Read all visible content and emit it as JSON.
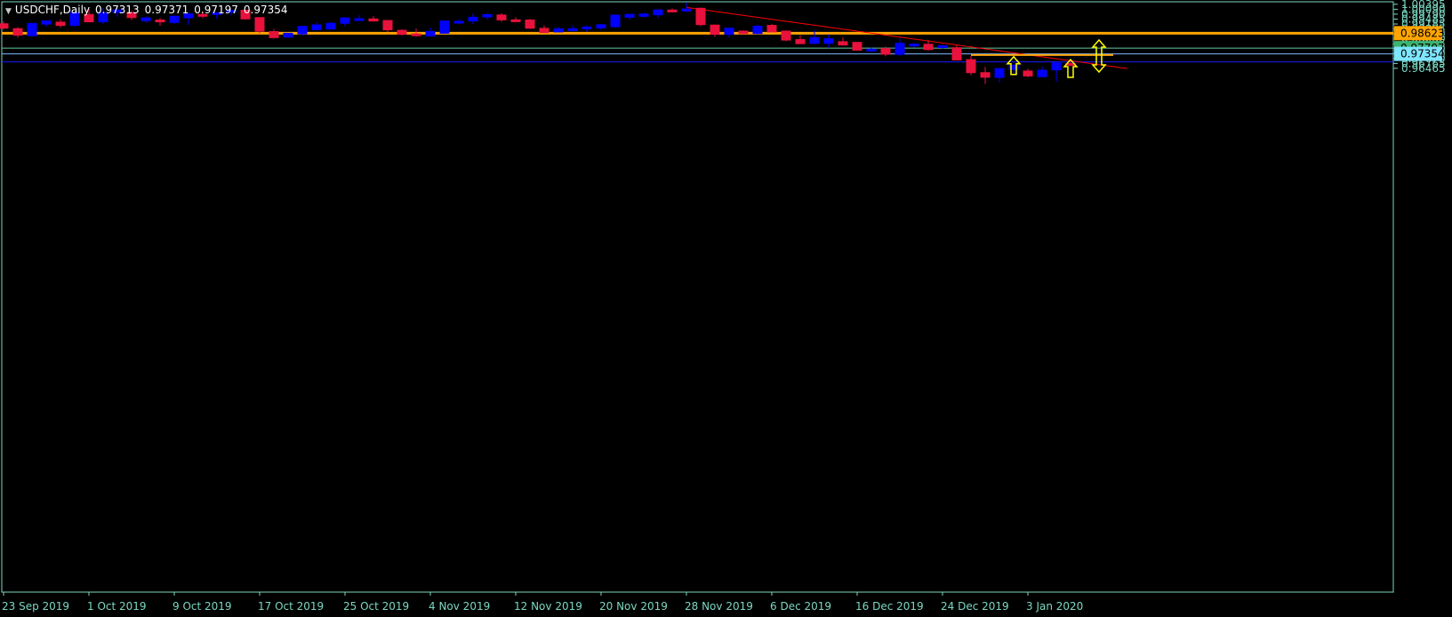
{
  "header": {
    "symbol": "USDCHF,Daily",
    "open": "0.97313",
    "high": "0.97371",
    "low": "0.97197",
    "close": "0.97354"
  },
  "colors": {
    "background": "#000000",
    "bull": "#0000ff",
    "bear": "#e8123c",
    "axis": "#7ad7c2",
    "trendline": "#ff0000",
    "support_line": "#ffa500",
    "resistance_line": "#66c9a0",
    "price_line": "#7ab8ff",
    "low_line": "#1a1aff",
    "arrows": "#ffff00"
  },
  "chart_data": {
    "type": "candlestick",
    "y_range": [
      0.6432,
      1.0055
    ],
    "y_ticks": [
      "1.00395",
      "1.00090",
      "0.99790",
      "0.99485",
      "0.99185",
      "0.98885",
      "0.98580",
      "0.98280",
      "0.97975",
      "0.97670",
      "0.97370",
      "0.97070",
      "0.96765",
      "0.96465"
    ],
    "x_labels": [
      "23 Sep 2019",
      "1 Oct 2019",
      "9 Oct 2019",
      "17 Oct 2019",
      "25 Oct 2019",
      "4 Nov 2019",
      "12 Nov 2019",
      "20 Nov 2019",
      "28 Nov 2019",
      "6 Dec 2019",
      "16 Dec 2019",
      "24 Dec 2019",
      "3 Jan 2020"
    ],
    "candles": [
      {
        "o": 0.992,
        "h": 0.9935,
        "l": 0.9885,
        "c": 0.9893
      },
      {
        "o": 0.989,
        "h": 0.99,
        "l": 0.9833,
        "c": 0.985
      },
      {
        "o": 0.9847,
        "h": 0.9925,
        "l": 0.984,
        "c": 0.9922
      },
      {
        "o": 0.9918,
        "h": 0.993,
        "l": 0.99,
        "c": 0.9938
      },
      {
        "o": 0.993,
        "h": 0.9947,
        "l": 0.9897,
        "c": 0.991
      },
      {
        "o": 0.991,
        "h": 0.9992,
        "l": 0.9903,
        "c": 0.999
      },
      {
        "o": 0.9977,
        "h": 1.0012,
        "l": 0.993,
        "c": 0.9932
      },
      {
        "o": 0.9932,
        "h": 1.0018,
        "l": 0.992,
        "c": 0.9988
      },
      {
        "o": 0.999,
        "h": 1.0024,
        "l": 0.9962,
        "c": 1.0005
      },
      {
        "o": 0.9988,
        "h": 1.0001,
        "l": 0.9943,
        "c": 0.9958
      },
      {
        "o": 0.9939,
        "h": 0.9964,
        "l": 0.9926,
        "c": 0.9956
      },
      {
        "o": 0.9943,
        "h": 0.9955,
        "l": 0.9908,
        "c": 0.9932
      },
      {
        "o": 0.9928,
        "h": 0.9972,
        "l": 0.992,
        "c": 0.9966
      },
      {
        "o": 0.9957,
        "h": 0.9992,
        "l": 0.9912,
        "c": 0.998
      },
      {
        "o": 0.9977,
        "h": 0.9995,
        "l": 0.9955,
        "c": 0.9975
      },
      {
        "o": 0.998,
        "h": 0.999,
        "l": 0.995,
        "c": 0.9988
      },
      {
        "o": 0.9994,
        "h": 1.0007,
        "l": 0.9972,
        "c": 1.0002
      },
      {
        "o": 1.0003,
        "h": 1.0005,
        "l": 0.9945,
        "c": 0.995
      },
      {
        "o": 0.9958,
        "h": 0.9958,
        "l": 0.9862,
        "c": 0.9875
      },
      {
        "o": 0.9872,
        "h": 0.9888,
        "l": 0.983,
        "c": 0.9835
      },
      {
        "o": 0.9838,
        "h": 0.9862,
        "l": 0.9835,
        "c": 0.9862
      },
      {
        "o": 0.9858,
        "h": 0.989,
        "l": 0.985,
        "c": 0.9904
      },
      {
        "o": 0.9884,
        "h": 0.9928,
        "l": 0.988,
        "c": 0.9913
      },
      {
        "o": 0.9888,
        "h": 0.993,
        "l": 0.9887,
        "c": 0.9923
      },
      {
        "o": 0.9923,
        "h": 0.994,
        "l": 0.9905,
        "c": 0.9956
      },
      {
        "o": 0.9945,
        "h": 0.9972,
        "l": 0.9945,
        "c": 0.9951
      },
      {
        "o": 0.995,
        "h": 0.9966,
        "l": 0.9935,
        "c": 0.9937
      },
      {
        "o": 0.994,
        "h": 0.9943,
        "l": 0.9868,
        "c": 0.9883
      },
      {
        "o": 0.988,
        "h": 0.9885,
        "l": 0.9848,
        "c": 0.9855
      },
      {
        "o": 0.9858,
        "h": 0.989,
        "l": 0.984,
        "c": 0.9847
      },
      {
        "o": 0.9845,
        "h": 0.9895,
        "l": 0.9842,
        "c": 0.9873
      },
      {
        "o": 0.9862,
        "h": 0.9935,
        "l": 0.986,
        "c": 0.9937
      },
      {
        "o": 0.9928,
        "h": 0.9945,
        "l": 0.992,
        "c": 0.9935
      },
      {
        "o": 0.9937,
        "h": 0.9983,
        "l": 0.992,
        "c": 0.996
      },
      {
        "o": 0.9962,
        "h": 0.9985,
        "l": 0.9945,
        "c": 0.9976
      },
      {
        "o": 0.9974,
        "h": 0.9985,
        "l": 0.9932,
        "c": 0.9944
      },
      {
        "o": 0.9944,
        "h": 0.996,
        "l": 0.9932,
        "c": 0.9941
      },
      {
        "o": 0.9943,
        "h": 0.995,
        "l": 0.9888,
        "c": 0.9893
      },
      {
        "o": 0.9892,
        "h": 0.991,
        "l": 0.987,
        "c": 0.9866
      },
      {
        "o": 0.987,
        "h": 0.99,
        "l": 0.987,
        "c": 0.9889
      },
      {
        "o": 0.9887,
        "h": 0.991,
        "l": 0.9874,
        "c": 0.9889
      },
      {
        "o": 0.9889,
        "h": 0.991,
        "l": 0.987,
        "c": 0.99
      },
      {
        "o": 0.9895,
        "h": 0.9917,
        "l": 0.9882,
        "c": 0.9914
      },
      {
        "o": 0.9902,
        "h": 0.9955,
        "l": 0.9893,
        "c": 0.9973
      },
      {
        "o": 0.996,
        "h": 0.9972,
        "l": 0.9945,
        "c": 0.9978
      },
      {
        "o": 0.9966,
        "h": 0.9986,
        "l": 0.9955,
        "c": 0.998
      },
      {
        "o": 0.9975,
        "h": 1.0005,
        "l": 0.9955,
        "c": 1.0005
      },
      {
        "o": 1.0004,
        "h": 1.0015,
        "l": 0.999,
        "c": 1.0
      },
      {
        "o": 1.0,
        "h": 1.005,
        "l": 0.9992,
        "c": 1.001
      },
      {
        "o": 1.0015,
        "h": 1.002,
        "l": 0.9905,
        "c": 0.9915
      },
      {
        "o": 0.9912,
        "h": 0.9915,
        "l": 0.984,
        "c": 0.9855
      },
      {
        "o": 0.9855,
        "h": 0.9885,
        "l": 0.9835,
        "c": 0.9893
      },
      {
        "o": 0.9875,
        "h": 0.988,
        "l": 0.9858,
        "c": 0.986
      },
      {
        "o": 0.986,
        "h": 0.9915,
        "l": 0.9855,
        "c": 0.9905
      },
      {
        "o": 0.991,
        "h": 0.992,
        "l": 0.987,
        "c": 0.987
      },
      {
        "o": 0.9875,
        "h": 0.988,
        "l": 0.9812,
        "c": 0.982
      },
      {
        "o": 0.9823,
        "h": 0.985,
        "l": 0.9798,
        "c": 0.9798
      },
      {
        "o": 0.98,
        "h": 0.988,
        "l": 0.9795,
        "c": 0.9835
      },
      {
        "o": 0.98,
        "h": 0.9855,
        "l": 0.977,
        "c": 0.9828
      },
      {
        "o": 0.981,
        "h": 0.9836,
        "l": 0.9786,
        "c": 0.979
      },
      {
        "o": 0.9806,
        "h": 0.9808,
        "l": 0.976,
        "c": 0.9758
      },
      {
        "o": 0.976,
        "h": 0.9776,
        "l": 0.975,
        "c": 0.9764
      },
      {
        "o": 0.9768,
        "h": 0.978,
        "l": 0.972,
        "c": 0.9733
      },
      {
        "o": 0.9732,
        "h": 0.9832,
        "l": 0.9722,
        "c": 0.98
      },
      {
        "o": 0.979,
        "h": 0.98,
        "l": 0.9775,
        "c": 0.9795
      },
      {
        "o": 0.9794,
        "h": 0.9821,
        "l": 0.9755,
        "c": 0.9762
      },
      {
        "o": 0.9778,
        "h": 0.979,
        "l": 0.9768,
        "c": 0.9785
      },
      {
        "o": 0.9773,
        "h": 0.979,
        "l": 0.9697,
        "c": 0.9698
      },
      {
        "o": 0.97,
        "h": 0.9722,
        "l": 0.9605,
        "c": 0.962
      },
      {
        "o": 0.962,
        "h": 0.9655,
        "l": 0.955,
        "c": 0.9592
      },
      {
        "o": 0.9591,
        "h": 0.9645,
        "l": 0.956,
        "c": 0.9645
      },
      {
        "o": 0.964,
        "h": 0.9675,
        "l": 0.961,
        "c": 0.9665
      },
      {
        "o": 0.963,
        "h": 0.9645,
        "l": 0.9592,
        "c": 0.96
      },
      {
        "o": 0.9595,
        "h": 0.966,
        "l": 0.9595,
        "c": 0.9635
      },
      {
        "o": 0.9637,
        "h": 0.9682,
        "l": 0.9566,
        "c": 0.968
      },
      {
        "o": 0.9676,
        "h": 0.9688,
        "l": 0.966,
        "c": 0.9672
      }
    ],
    "horizontal_lines": [
      {
        "price": 0.98623,
        "label": "0.98623",
        "style": "support"
      },
      {
        "price": 0.97707,
        "label": "0.97707",
        "style": "resistance"
      },
      {
        "price": 0.97354,
        "label": "0.97354",
        "style": "price"
      },
      {
        "price": 0.9686,
        "label": "",
        "style": "low"
      }
    ],
    "trendline": {
      "from": {
        "bar": 48,
        "price": 1.002
      },
      "to": {
        "bar": 79,
        "price": 0.9645
      }
    },
    "short_segment": {
      "from_bar": 68,
      "to_bar": 78,
      "price": 0.9728
    },
    "arrows": [
      {
        "bar": 71,
        "price": 0.9658,
        "dir": "up"
      },
      {
        "bar": 75,
        "price": 0.964,
        "dir": "up"
      },
      {
        "bar": 77,
        "price": 0.9722,
        "dir": "updown"
      }
    ]
  }
}
